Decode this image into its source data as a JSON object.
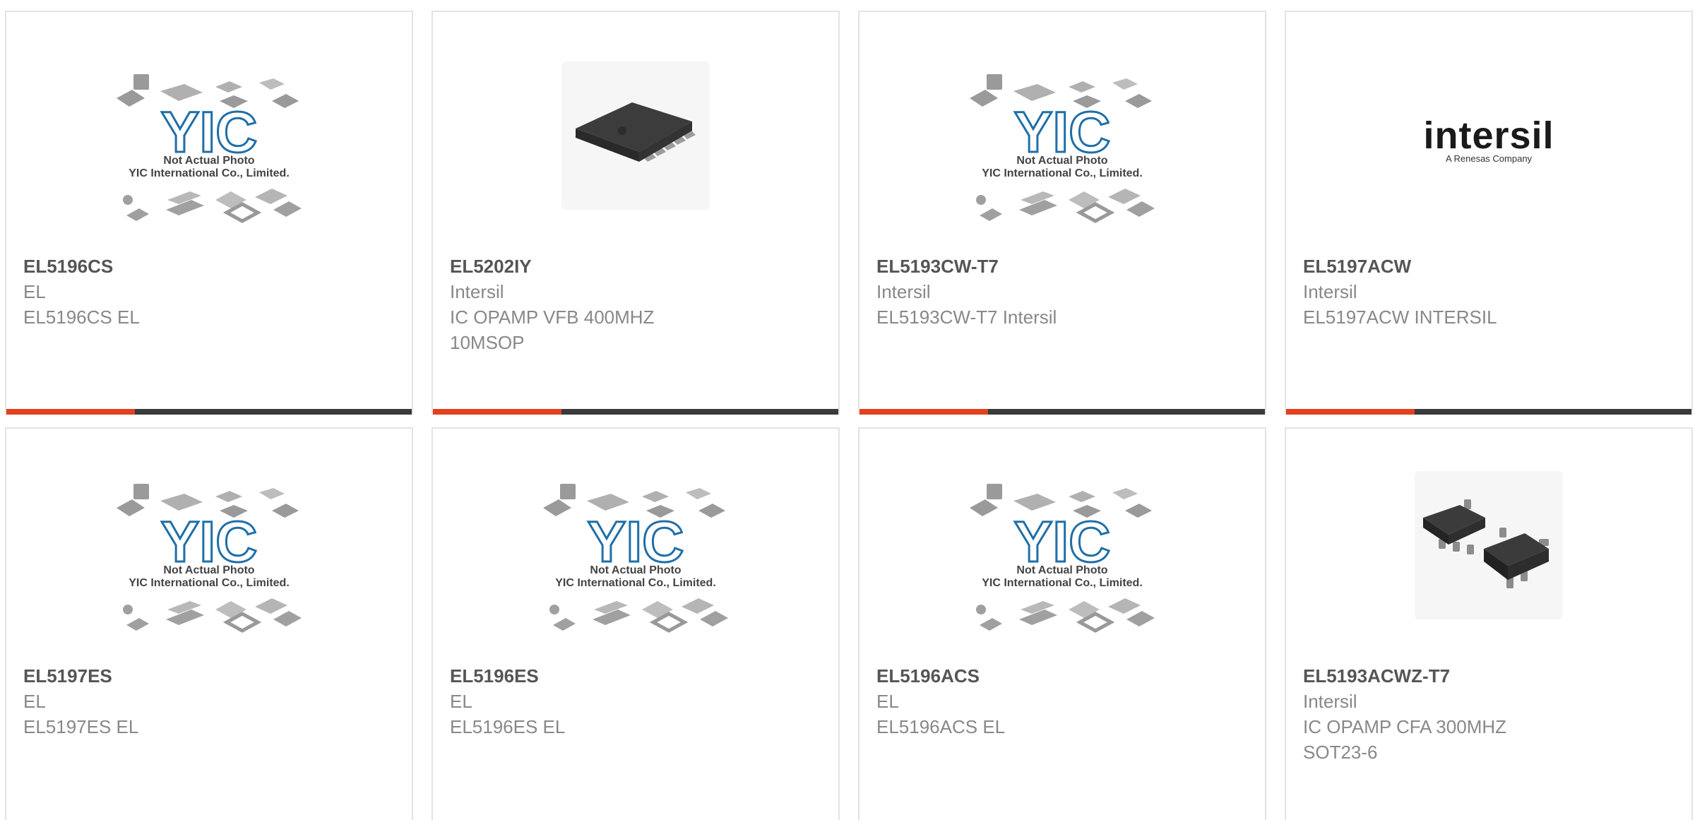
{
  "colors": {
    "accent": "#e2401f",
    "bar": "#3a3a3a",
    "border": "#e3e3e3"
  },
  "placeholder": {
    "line1": "Not Actual Photo",
    "line2": "YIC International Co., Limited.",
    "brand": "YIC"
  },
  "logo": {
    "word": "intersil",
    "tagline": "A Renesas Company"
  },
  "products": [
    {
      "part": "EL5196CS",
      "mfr": "EL",
      "desc": "EL5196CS EL",
      "image": "placeholder"
    },
    {
      "part": "EL5202IY",
      "mfr": "Intersil",
      "desc": "IC OPAMP VFB 400MHZ 10MSOP",
      "image": "msop-chip-photo"
    },
    {
      "part": "EL5193CW-T7",
      "mfr": "Intersil",
      "desc": "EL5193CW-T7 Intersil",
      "image": "placeholder"
    },
    {
      "part": "EL5197ACW",
      "mfr": "Intersil",
      "desc": "EL5197ACW INTERSIL",
      "image": "intersil-logo"
    },
    {
      "part": "EL5197ES",
      "mfr": "EL",
      "desc": "EL5197ES EL",
      "image": "placeholder"
    },
    {
      "part": "EL5196ES",
      "mfr": "EL",
      "desc": "EL5196ES EL",
      "image": "placeholder"
    },
    {
      "part": "EL5196ACS",
      "mfr": "EL",
      "desc": "EL5196ACS EL",
      "image": "placeholder"
    },
    {
      "part": "EL5193ACWZ-T7",
      "mfr": "Intersil",
      "desc": "IC OPAMP CFA 300MHZ SOT23-6",
      "image": "sot23-chip-photo"
    }
  ]
}
